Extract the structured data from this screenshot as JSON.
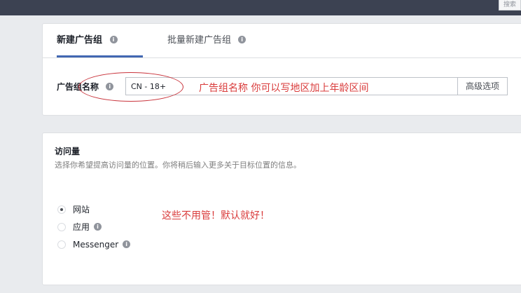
{
  "topbar": {
    "corner_button": "搜索"
  },
  "tabs": [
    {
      "label": "新建广告组",
      "active": true
    },
    {
      "label": "批量新建广告组",
      "active": false
    }
  ],
  "ad_set_name": {
    "label": "广告组名称",
    "value": "CN - 18+",
    "advanced_label": "高级选项",
    "annotation": "广告组名称 你可以写地区加上年龄区间"
  },
  "traffic": {
    "title": "访问量",
    "description": "选择你希望提高访问量的位置。你将稍后输入更多关于目标位置的信息。",
    "options": [
      {
        "label": "网站",
        "selected": true,
        "info": false
      },
      {
        "label": "应用",
        "selected": false,
        "info": true
      },
      {
        "label": "Messenger",
        "selected": false,
        "info": true
      }
    ],
    "annotation": "这些不用管！默认就好！"
  },
  "colors": {
    "accent": "#4267b2",
    "annotation": "#d93b3b",
    "topbar": "#3c4252"
  },
  "icons": {
    "info": "i"
  }
}
